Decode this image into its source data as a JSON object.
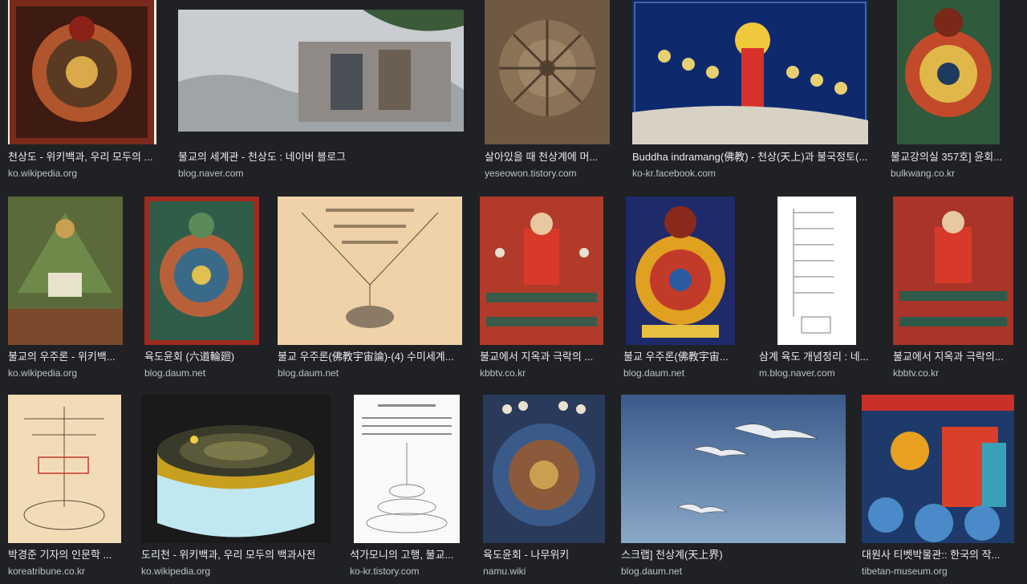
{
  "results": [
    {
      "caption": "천상도 - 위키백과, 우리 모두의 ...",
      "source": "ko.wikipedia.org"
    },
    {
      "caption": "불교의 세계관 - 천상도 : 네이버 블로그",
      "source": "blog.naver.com"
    },
    {
      "caption": "살아있을 때 천상계에 머...",
      "source": "yeseowon.tistory.com"
    },
    {
      "caption": "Buddha indramang(佛教) - 천상(天上)과 불국정토(...",
      "source": "ko-kr.facebook.com"
    },
    {
      "caption": "불교강의실 357호] 윤회...",
      "source": "bulkwang.co.kr"
    },
    {
      "caption": "불교의 우주론 - 위키백...",
      "source": "ko.wikipedia.org"
    },
    {
      "caption": "육도윤회 (六道輪廻)",
      "source": "blog.daum.net"
    },
    {
      "caption": "불교 우주론(佛教宇宙論)-(4) 수미세계...",
      "source": "blog.daum.net"
    },
    {
      "caption": "불교에서 지옥과 극락의 ...",
      "source": "kbbtv.co.kr"
    },
    {
      "caption": "불교 우주론(佛教宇宙...",
      "source": "blog.daum.net"
    },
    {
      "caption": "삼계 육도 개념정리 : 네...",
      "source": "m.blog.naver.com"
    },
    {
      "caption": "불교에서 지옥과 극락의...",
      "source": "kbbtv.co.kr"
    },
    {
      "caption": "박경준 기자의 인문학 ...",
      "source": "koreatribune.co.kr"
    },
    {
      "caption": "도리천 - 위키백과, 우리 모두의 백과사전",
      "source": "ko.wikipedia.org"
    },
    {
      "caption": "석가모니의 고행, 불교...",
      "source": "ko-kr.tistory.com"
    },
    {
      "caption": "육도윤회 - 나무위키",
      "source": "namu.wiki"
    },
    {
      "caption": "스크랩] 천상계(天上界)",
      "source": "blog.daum.net"
    },
    {
      "caption": "대원사 티벳박물관:: 한국의 작...",
      "source": "tibetan-museum.org"
    }
  ],
  "colors": {
    "background": "#202124",
    "caption_text": "#e8eaed",
    "source_text": "#bdc1c6"
  }
}
